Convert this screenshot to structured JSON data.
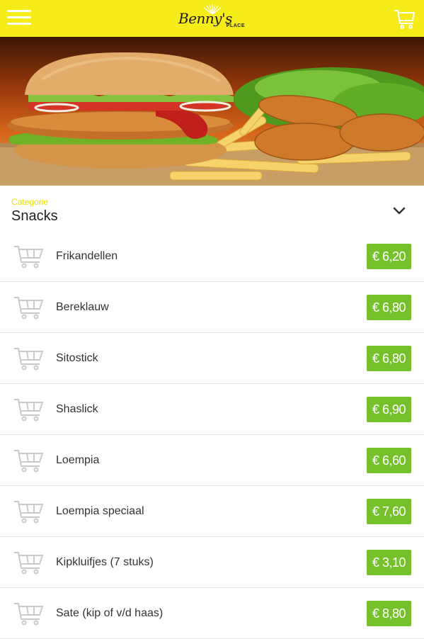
{
  "header": {
    "logo_text": "Benny's",
    "logo_subtext": "PLACE",
    "cart_count": "0"
  },
  "category": {
    "label": "Categorie",
    "value": "Snacks"
  },
  "products": [
    {
      "name": "Frikandellen",
      "price": "€ 6,20"
    },
    {
      "name": "Bereklauw",
      "price": "€ 6,80"
    },
    {
      "name": "Sitostick",
      "price": "€ 6,80"
    },
    {
      "name": "Shaslick",
      "price": "€ 6,90"
    },
    {
      "name": "Loempia",
      "price": "€ 6,60"
    },
    {
      "name": "Loempia speciaal",
      "price": "€ 7,60"
    },
    {
      "name": "Kipkluifjes (7 stuks)",
      "price": "€ 3,10"
    },
    {
      "name": "Sate (kip of v/d haas)",
      "price": "€ 8,80"
    }
  ],
  "colors": {
    "header": "#f5ec1a",
    "price_badge": "#76c12b",
    "category_label": "#e8e000"
  }
}
